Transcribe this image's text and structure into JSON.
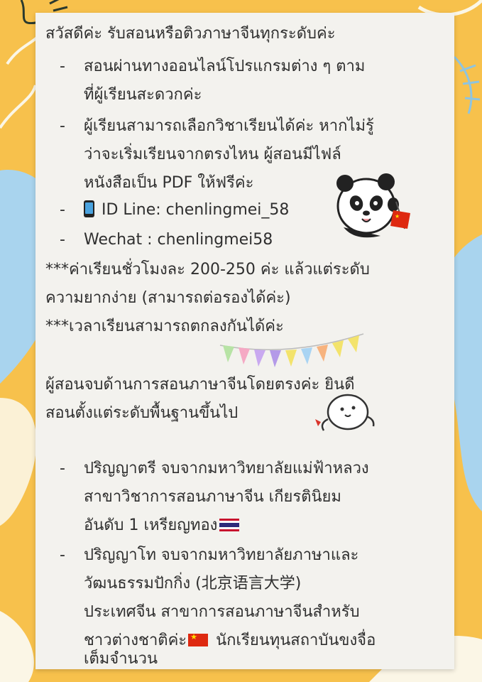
{
  "intro": "สวัสดีค่ะ รับสอนหรือติวภาษาจีนทุกระดับค่ะ",
  "bullets_top": [
    {
      "lines": [
        "สอนผ่านทางออนไลน์โปรแกรมต่าง ๆ ตาม",
        "ที่ผู้เรียนสะดวกค่ะ"
      ]
    },
    {
      "lines": [
        "ผู้เรียนสามารถเลือกวิชาเรียนได้ค่ะ หากไม่รู้",
        "ว่าจะเริ่มเรียนจากตรงไหน ผู้สอนมีไฟล์",
        "หนังสือเป็น PDF ให้ฟรีค่ะ"
      ]
    }
  ],
  "contact": {
    "line_id": "ID Line: chenlingmei_58",
    "wechat": "Wechat : chenlingmei58",
    "phone_icon": "mobile-phone-icon"
  },
  "notes": {
    "fee_line1": "***ค่าเรียนชั่วโมงละ 200-250 ค่ะ แล้วแต่ระดับ",
    "fee_line2": "ความยากง่าย (สามารถต่อรองได้ค่ะ)",
    "time": "***เวลาเรียนสามารถตกลงกันได้ค่ะ"
  },
  "tutor_intro": {
    "line1": "ผู้สอนจบด้านการสอนภาษาจีนโดยตรงค่ะ ยินดี",
    "line2": "สอนตั้งแต่ระดับพื้นฐานขึ้นไป"
  },
  "education": {
    "bachelor": [
      "ปริญญาตรี จบจากมหาวิทยาลัยแม่ฟ้าหลวง",
      "สาขาวิชาการสอนภาษาจีน เกียรตินิยม",
      "อันดับ 1 เหรียญทอง"
    ],
    "master": [
      "ปริญญาโท จบจากมหาวิทยาลัยภาษาและ",
      "วัฒนธรรมปักกิ่ง   (北京语言大学)",
      "ประเทศจีน สาขาการสอนภาษาจีนสำหรับ",
      "ชาวต่างชาติค่ะ",
      " นักเรียนทุนสถาบันขงจื่อ",
      "เต็มจำนวน"
    ]
  },
  "dash": "-",
  "colors": {
    "background": "#f7c14c",
    "card": "#f3f2ee",
    "text": "#2f2f2f",
    "blue_shape": "#a9d4ee",
    "white_shape": "#fbf6e6"
  },
  "stickers": {
    "panda": "panda-with-china-flag-sticker",
    "bunting": "pastel-bunting-flags-sticker",
    "doodle": "white-bun-character-sticker",
    "flag_th": "thailand-flag-icon",
    "flag_cn": "china-flag-icon"
  }
}
